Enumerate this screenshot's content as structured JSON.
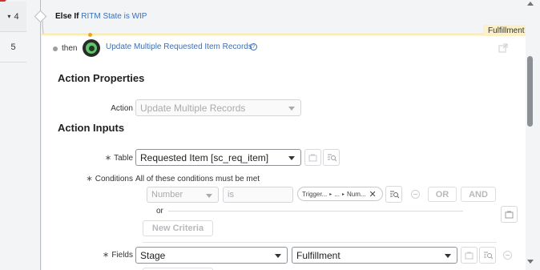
{
  "gutter": {
    "rows": [
      "4",
      "5"
    ]
  },
  "else_if": {
    "keyword": "Else If",
    "condition": "RITM State is WIP"
  },
  "stage_tag": "Fulfillment",
  "then_row": {
    "then_label": "then",
    "action_title": "Update Multiple Requested Item Records"
  },
  "action_properties": {
    "title": "Action Properties",
    "action_label": "Action",
    "action_value": "Update Multiple Records"
  },
  "action_inputs": {
    "title": "Action Inputs",
    "table_label": "Table",
    "table_value": "Requested Item [sc_req_item]",
    "conditions_label": "Conditions",
    "conditions_text": "All of these conditions must be met",
    "cond_field": "Number",
    "cond_operator": "is",
    "cond_pill": {
      "part1": "Trigger...",
      "part2": "...",
      "part3": "Num..."
    },
    "or_button": "OR",
    "and_button": "AND",
    "or_text": "or",
    "new_criteria": "New Criteria",
    "fields_label": "Fields",
    "field_name": "Stage",
    "field_value": "Fulfillment"
  },
  "required_marker": "∗"
}
